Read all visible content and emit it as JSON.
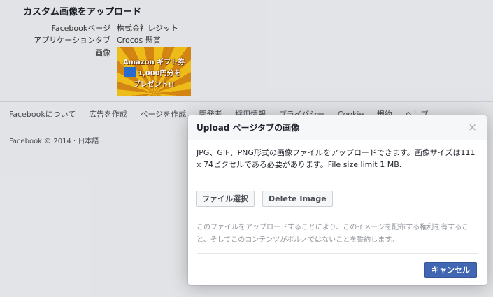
{
  "page": {
    "title": "カスタム画像をアップロード",
    "rows": [
      {
        "label": "Facebookページ",
        "value": "株式会社レジット"
      },
      {
        "label": "アプリケーションタブ",
        "value": "Crocos 懸賞"
      },
      {
        "label": "画像",
        "value": ""
      }
    ],
    "thumbnail": {
      "line1": "Amazon ギフト券",
      "line2": "1,000円分を",
      "line3": "プレゼント!!"
    }
  },
  "footer": {
    "links": [
      "Facebookについて",
      "広告を作成",
      "ページを作成",
      "開発者",
      "採用情報",
      "プライバシー",
      "Cookie",
      "規約",
      "ヘルプ"
    ],
    "copyright": "Facebook © 2014 ·",
    "language": "日本語"
  },
  "dialog": {
    "title": "Upload ページタブの画像",
    "close_symbol": "×",
    "description": "JPG、GIF、PNG形式の画像ファイルをアップロードできます。画像サイズは111 x 74ピクセルである必要があります。File size limit 1 MB.",
    "choose_file_label": "ファイル選択",
    "delete_image_label": "Delete Image",
    "terms": "このファイルをアップロードすることにより、このイメージを配布する権利を有すること、そしてこのコンテンツがポルノではないことを誓約します。",
    "cancel_label": "キャンセル"
  },
  "colors": {
    "accent": "#4267b2",
    "background": "#e9ebee",
    "dialog_header": "#f6f7f9"
  }
}
